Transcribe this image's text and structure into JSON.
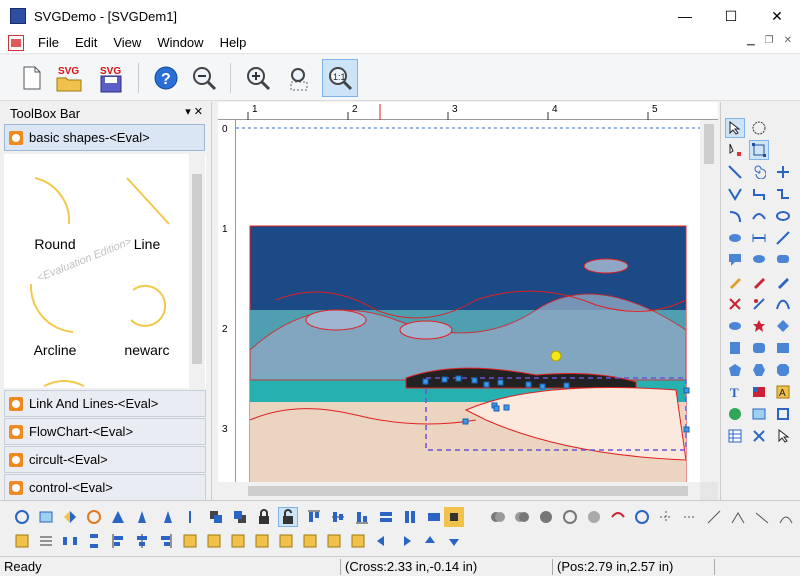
{
  "window": {
    "title": "SVGDemo - [SVGDem1]",
    "buttons": [
      "—",
      "☐",
      "✕"
    ]
  },
  "menu": [
    "File",
    "Edit",
    "View",
    "Window",
    "Help"
  ],
  "mdi_buttons": [
    "▁",
    "❐",
    "✕"
  ],
  "toolbar": {
    "svg_label_1": "SVG",
    "svg_label_2": "SVG"
  },
  "toolbox": {
    "title": "ToolBox Bar",
    "header_controls": "▾ ✕",
    "open_section": "basic shapes-<Eval>",
    "shapes": [
      {
        "label": "Round"
      },
      {
        "label": "Line"
      },
      {
        "label": "Arcline"
      },
      {
        "label": "newarc"
      }
    ],
    "watermark": "<Evaluation Edition>",
    "sections": [
      "Link And Lines-<Eval>",
      "FlowChart-<Eval>",
      "circult-<Eval>",
      "control-<Eval>"
    ]
  },
  "ruler": {
    "h_labels": [
      "1",
      "2",
      "3",
      "4",
      "5"
    ],
    "v_labels": [
      "0",
      "1",
      "2",
      "3"
    ]
  },
  "status": {
    "ready": "Ready",
    "cross": "(Cross:2.33 in,-0.14 in)",
    "pos": "(Pos:2.79 in,2.57 in)"
  },
  "colors": {
    "accent": "#7eb4ea",
    "shape_stroke": "#f2c94c",
    "selection": "#3a6fd8",
    "image_border": "#e02020"
  }
}
